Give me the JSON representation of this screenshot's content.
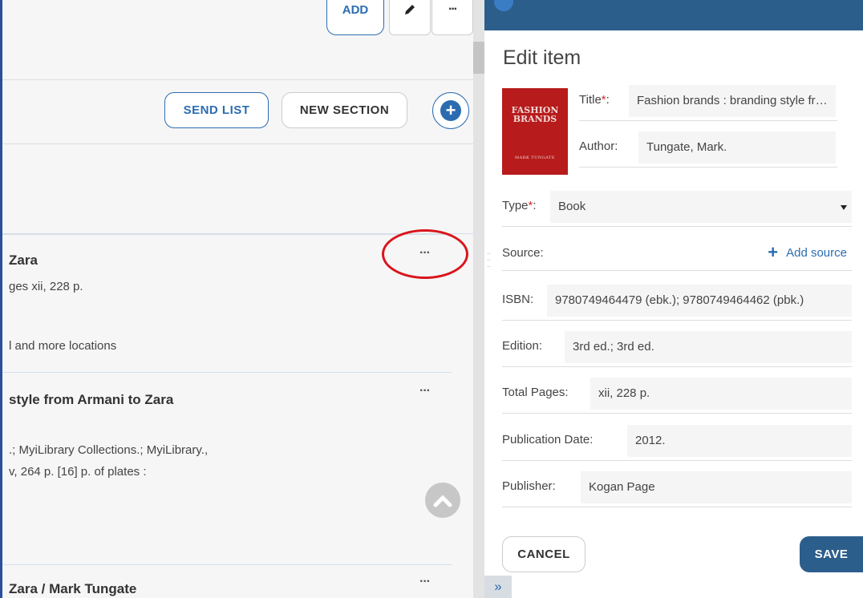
{
  "left": {
    "toolbar": {
      "add_label": "ADD",
      "edit_icon": "pencil-icon",
      "more_icon": "more-dots-icon",
      "more_label": "···"
    },
    "section_bar": {
      "send_list_label": "SEND LIST",
      "new_section_label": "NEW SECTION",
      "add_section_label": "+"
    },
    "items": [
      {
        "title": "Zara",
        "line1": "ges xii, 228 p.",
        "line2": "",
        "line3": "l and more locations",
        "more": "···"
      },
      {
        "title": "style from Armani to Zara",
        "line1": ".; MyiLibrary Collections.; MyiLibrary.,",
        "line2": "v, 264 p. [16] p. of plates :",
        "more": "···"
      },
      {
        "title": "Zara / Mark Tungate",
        "more": "···"
      }
    ]
  },
  "panel": {
    "title": "Edit item",
    "cover": {
      "title_line1": "FASHION",
      "title_line2": "BRANDS",
      "author": "MARK TUNGATE"
    },
    "fields": {
      "title_label": "Title",
      "title_value": "Fashion brands : branding style from Armani to Zara",
      "author_label": "Author:",
      "author_value": "Tungate, Mark.",
      "type_label": "Type",
      "type_value": "Book",
      "source_label": "Source:",
      "add_source_label": "Add source",
      "isbn_label": "ISBN:",
      "isbn_value": "9780749464479 (ebk.); 9780749464462 (pbk.)",
      "edition_label": "Edition:",
      "edition_value": "3rd ed.; 3rd ed.",
      "pages_label": "Total Pages:",
      "pages_value": "xii, 228 p.",
      "pubdate_label": "Publication Date:",
      "pubdate_value": "2012.",
      "publisher_label": "Publisher:",
      "publisher_value": "Kogan Page",
      "required_mark": "*",
      "colon": ":"
    },
    "cancel_label": "CANCEL",
    "save_label": "SAVE",
    "expand_label": "»"
  },
  "colors": {
    "accent": "#2b6cb0",
    "header": "#2c5e8c",
    "highlight_ring": "#d9151b",
    "required": "#d32f2f"
  }
}
